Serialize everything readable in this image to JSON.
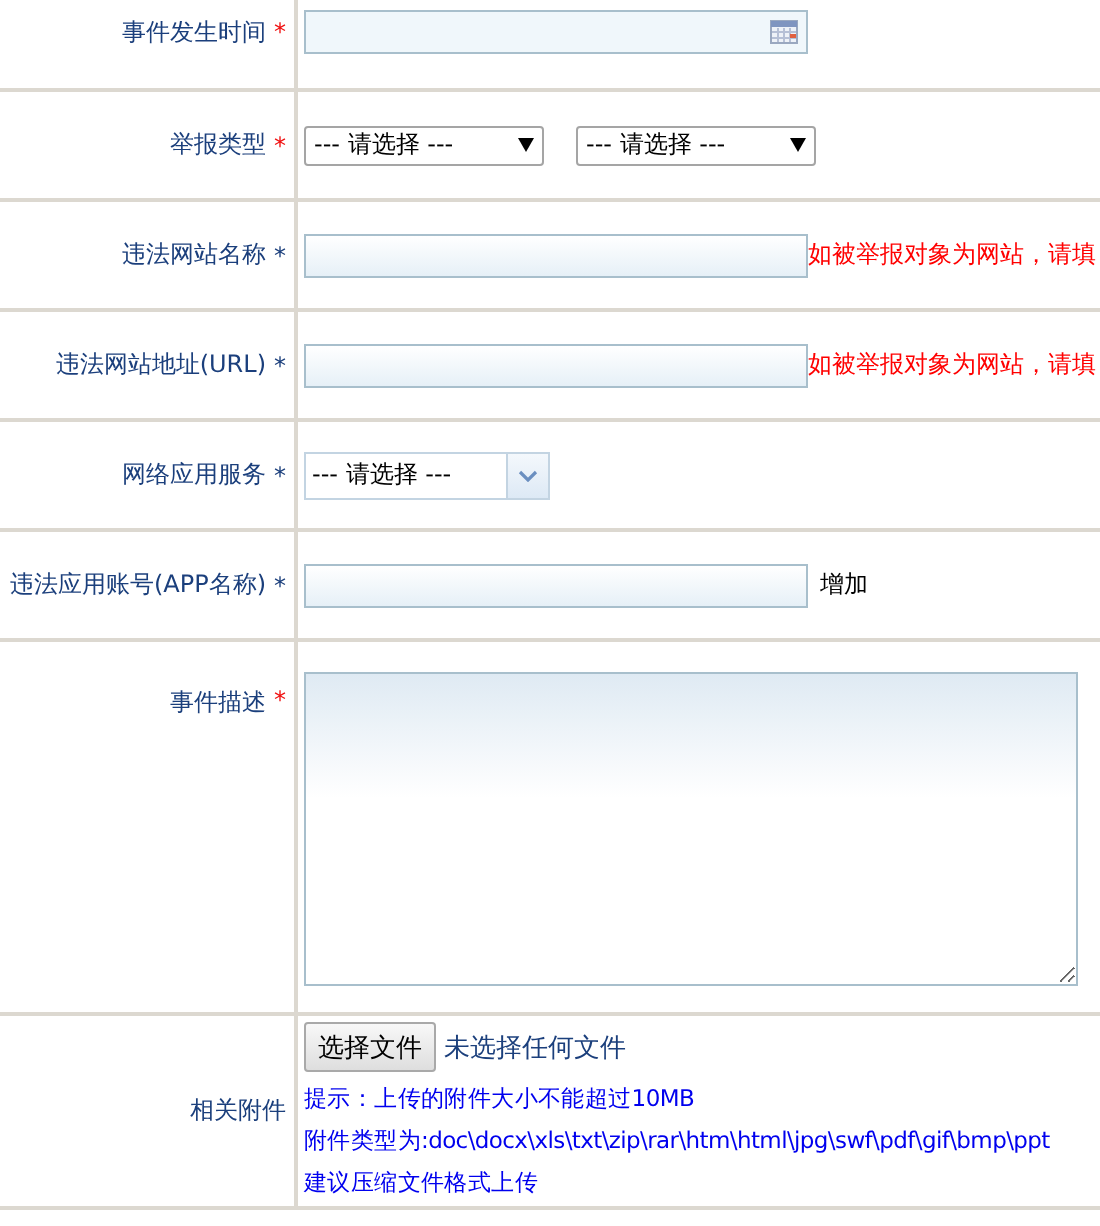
{
  "rows": [
    {
      "kind": "date",
      "label": "事件发生时间",
      "mark": {
        "text": "*",
        "color": "#f01010"
      }
    },
    {
      "kind": "selects",
      "label": "举报类型",
      "mark": {
        "text": "*",
        "color": "#f01010"
      },
      "selects": [
        "--- 请选择 ---",
        "--- 请选择 ---"
      ]
    },
    {
      "kind": "text",
      "label": "违法网站名称",
      "mark": {
        "text": "*",
        "color": "#1b3f7c"
      },
      "hint": "如被举报对象为网站，请填"
    },
    {
      "kind": "text",
      "label": "违法网站地址(URL)",
      "mark": {
        "text": "*",
        "color": "#1b3f7c"
      },
      "hint": "如被举报对象为网站，请填"
    },
    {
      "kind": "combo",
      "label": "网络应用服务",
      "mark": {
        "text": "*",
        "color": "#1b3f7c"
      },
      "value": "--- 请选择 ---"
    },
    {
      "kind": "text",
      "label": "违法应用账号(APP名称)",
      "mark": {
        "text": "*",
        "color": "#1b3f7c"
      },
      "action": "增加"
    },
    {
      "kind": "textarea",
      "label": "事件描述",
      "mark": {
        "text": "*",
        "color": "#f01010"
      }
    },
    {
      "kind": "file",
      "label": "相关附件",
      "button": "选择文件",
      "status": "未选择任何文件",
      "notes": [
        "提示：上传的附件大小不能超过10MB",
        "附件类型为:doc\\docx\\xls\\txt\\zip\\rar\\htm\\html\\jpg\\swf\\pdf\\gif\\bmp\\ppt",
        "建议压缩文件格式上传"
      ]
    }
  ]
}
